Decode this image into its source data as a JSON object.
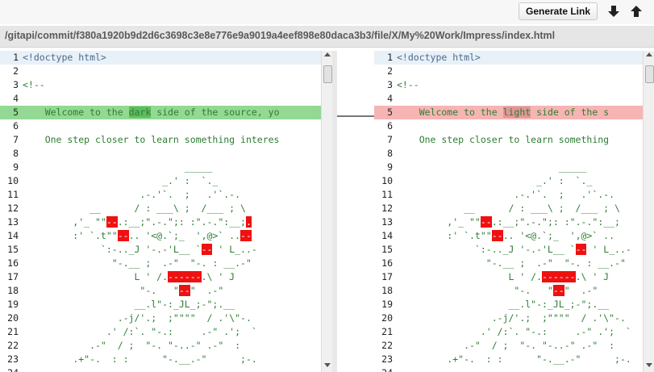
{
  "toolbar": {
    "generate_link_label": "Generate Link"
  },
  "path": "/gitapi/commit/f380a1920b9d2d6c3698c3e8e776e9a9019a4eef898e80daca3b3/file/X/My%20Work/Impress/index.html",
  "left": {
    "lines": [
      {
        "n": "1",
        "pre": "<!doctype html>",
        "word": "",
        "post": "",
        "type": "doctype"
      },
      {
        "n": "2",
        "pre": "",
        "word": "",
        "post": ""
      },
      {
        "n": "3",
        "pre": "<!--",
        "word": "",
        "post": ""
      },
      {
        "n": "4",
        "pre": "",
        "word": "",
        "post": ""
      },
      {
        "n": "5",
        "pre": "    Welcome to the ",
        "word": "dark",
        "post": " side of the source, yo",
        "type": "changed"
      },
      {
        "n": "6",
        "pre": "",
        "word": "",
        "post": ""
      },
      {
        "n": "7",
        "pre": "    One step closer to learn something interes",
        "word": "",
        "post": ""
      },
      {
        "n": "8",
        "pre": "",
        "word": "",
        "post": ""
      },
      {
        "n": "9",
        "pre": "                             _____",
        "word": "",
        "post": ""
      },
      {
        "n": "10",
        "pre": "                         _.' :  `._",
        "word": "",
        "post": ""
      },
      {
        "n": "11",
        "pre": "                     .-.'`.  ;   .'`.-.",
        "word": "",
        "post": ""
      },
      {
        "n": "12",
        "pre": "            __      / : ___\\ ;  /___ ; \\",
        "word": "",
        "post": ""
      },
      {
        "n": "13",
        "pre": "         ,'_ \"\"",
        "word": "--",
        "post": ".:__;\".-.\";: :\".-.\":__;",
        "mark2": "."
      },
      {
        "n": "14",
        "pre": "         :' `.t\"\"",
        "word": "--",
        "post": ".. '<@.`;_  ',@>` ..",
        "mark2": "--"
      },
      {
        "n": "15",
        "pre": "              `:-.._J '-.-'L__ `",
        "word": "--",
        "post": " ' L_..-"
      },
      {
        "n": "16",
        "pre": "                \"-.__ ;  .-\"  \"-. : __.-\"",
        "word": "",
        "post": ""
      },
      {
        "n": "17",
        "pre": "                    L ' /.",
        "word": "------",
        "post": ".\\ ' J"
      },
      {
        "n": "18",
        "pre": "                     \"-.   \"",
        "word": "--",
        "post": "\"  .-\""
      },
      {
        "n": "19",
        "pre": "                    __.l\"-:_JL_;-\";.__",
        "word": "",
        "post": ""
      },
      {
        "n": "20",
        "pre": "                 .-j/'.;  ;\"\"\"\"  / .'\\\"-.",
        "word": "",
        "post": ""
      },
      {
        "n": "21",
        "pre": "               .' /:`. \"-.:     .-\" .';  `",
        "word": "",
        "post": ""
      },
      {
        "n": "22",
        "pre": "            .-\"  / ;  \"-. \"-..-\" .-\"  :",
        "word": "",
        "post": ""
      },
      {
        "n": "23",
        "pre": "         .+\"-.  : :      \"-.__.-\"      ;-.",
        "word": "",
        "post": ""
      },
      {
        "n": "24",
        "pre": "",
        "word": "",
        "post": ""
      }
    ]
  },
  "right": {
    "lines": [
      {
        "n": "1",
        "pre": "<!doctype html>",
        "word": "",
        "post": "",
        "type": "doctype"
      },
      {
        "n": "2",
        "pre": "",
        "word": "",
        "post": ""
      },
      {
        "n": "3",
        "pre": "<!--",
        "word": "",
        "post": ""
      },
      {
        "n": "4",
        "pre": "",
        "word": "",
        "post": ""
      },
      {
        "n": "5",
        "pre": "    Welcome to the ",
        "word": "light",
        "post": " side of the s",
        "type": "changed"
      },
      {
        "n": "6",
        "pre": "",
        "word": "",
        "post": ""
      },
      {
        "n": "7",
        "pre": "    One step closer to learn something",
        "word": "",
        "post": ""
      },
      {
        "n": "8",
        "pre": "",
        "word": "",
        "post": ""
      },
      {
        "n": "9",
        "pre": "                             _____",
        "word": "",
        "post": ""
      },
      {
        "n": "10",
        "pre": "                         _.' :  `._",
        "word": "",
        "post": ""
      },
      {
        "n": "11",
        "pre": "                     .-.'`.  ;   .'`.-.",
        "word": "",
        "post": ""
      },
      {
        "n": "12",
        "pre": "            __      / : ___\\ ;  /___ ; \\",
        "word": "",
        "post": ""
      },
      {
        "n": "13",
        "pre": "         ,'_ \"\"",
        "word": "--",
        "post": ".:__;\".-.\";: :\".-.\":__;"
      },
      {
        "n": "14",
        "pre": "         :' `.t\"\"",
        "word": "--",
        "post": ".. '<@.`;_  ',@>` .."
      },
      {
        "n": "15",
        "pre": "              `:-.._J '-.-'L__ `",
        "word": "--",
        "post": " ' L_..-"
      },
      {
        "n": "16",
        "pre": "                \"-.__ ;  .-\"  \"-. : __.-\"",
        "word": "",
        "post": ""
      },
      {
        "n": "17",
        "pre": "                    L ' /.",
        "word": "------",
        "post": ".\\ ' J"
      },
      {
        "n": "18",
        "pre": "                     \"-.   \"",
        "word": "--",
        "post": "\"  .-\""
      },
      {
        "n": "19",
        "pre": "                    __.l\"-:_JL_;-\";.__",
        "word": "",
        "post": ""
      },
      {
        "n": "20",
        "pre": "                 .-j/'.;  ;\"\"\"\"  / .'\\\"-.",
        "word": "",
        "post": ""
      },
      {
        "n": "21",
        "pre": "               .' /:`. \"-.:     .-\" .';  `",
        "word": "",
        "post": ""
      },
      {
        "n": "22",
        "pre": "            .-\"  / ;  \"-. \"-..-\" .-\"  :",
        "word": "",
        "post": ""
      },
      {
        "n": "23",
        "pre": "         .+\"-.  : :      \"-.__.-\"      ;-.",
        "word": "",
        "post": ""
      },
      {
        "n": "24",
        "pre": "",
        "word": "",
        "post": ""
      }
    ]
  },
  "icons": {
    "download": "arrow-down-icon",
    "upload": "arrow-up-icon"
  }
}
